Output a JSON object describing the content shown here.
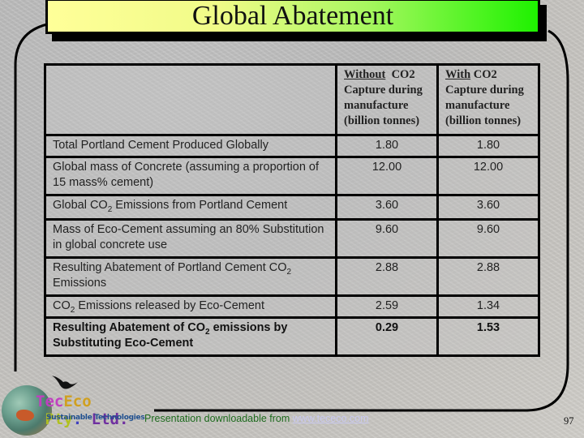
{
  "slide": {
    "title": "Global Abatement",
    "page_number": "97"
  },
  "table": {
    "header": {
      "col1": "",
      "col2": {
        "emph": "Without",
        "rest_line1": "  CO2",
        "lines": [
          "Capture during",
          "manufacture",
          "(billion tonnes)"
        ]
      },
      "col3": {
        "emph": "With",
        "rest_line1": " CO2",
        "lines": [
          "Capture during",
          "manufacture",
          "(billion tonnes)"
        ]
      }
    },
    "rows": [
      {
        "label": "Total Portland Cement Produced Globally",
        "without": "1.80",
        "with": "1.80"
      },
      {
        "label": "Global mass of Concrete (assuming a proportion of 15 mass% cement)",
        "without": "12.00",
        "with": "12.00"
      },
      {
        "label_pre": "Global CO",
        "label_sub": "2",
        "label_post": " Emissions from Portland Cement",
        "without": "3.60",
        "with": "3.60"
      },
      {
        "label": "Mass of Eco-Cement assuming an 80% Substitution in global concrete use",
        "without": "9.60",
        "with": "9.60"
      },
      {
        "label_pre": "Resulting Abatement of Portland Cement CO",
        "label_sub": "2",
        "label_post": " Emissions",
        "without": "2.88",
        "with": "2.88"
      },
      {
        "label_pre": "CO",
        "label_sub": "2",
        "label_post": " Emissions released by Eco-Cement",
        "without": "2.59",
        "with": "1.34"
      },
      {
        "label_pre": "Resulting Abatement of CO",
        "label_sub": "2",
        "label_post": " emissions by Substituting Eco-Cement",
        "without": "0.29",
        "with": "1.53",
        "bold": true
      }
    ]
  },
  "logo": {
    "brand_parts": [
      "Tec",
      "Eco",
      " ",
      "Pty",
      ". ",
      "Ltd."
    ],
    "tagline": "Sustainable Technologies",
    "icons": [
      "globe-icon",
      "bird-icon"
    ]
  },
  "footer": {
    "text": "Presentation downloadable from ",
    "link": "www.tececo.com"
  },
  "colors": {
    "title_gradient_start": "#ffff99",
    "title_gradient_end": "#1ef200",
    "footer_text": "#1e6b1e",
    "link": "#c8c8f0"
  }
}
